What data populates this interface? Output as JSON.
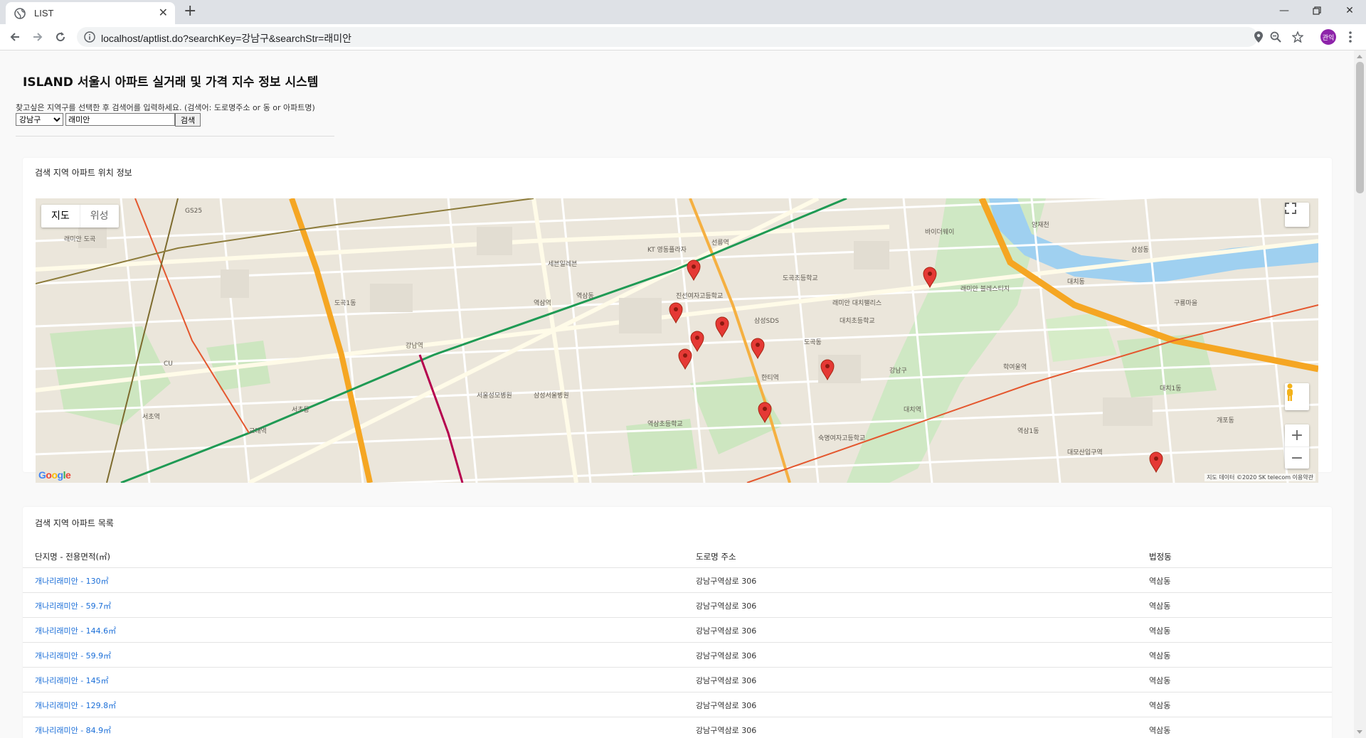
{
  "browser": {
    "tab_title": "LIST",
    "url": "localhost/aptlist.do?searchKey=강남구&searchStr=래미안",
    "profile_initials": "관익"
  },
  "page": {
    "title": "ISLAND 서울시 아파트 실거래 및 가격 지수 정보 시스템",
    "hint": "찾고싶은 지역구를 선택한 후 검색어를 입력하세요. (검색어: 도로명주소 or 동 or 아파트명)",
    "district_selected": "강남구",
    "search_value": "래미안",
    "search_button": "검색"
  },
  "map_card": {
    "title": "검색 지역 아파트 위치 정보",
    "map_tab": "지도",
    "satellite_tab": "위성",
    "attribution": "지도 데이터 ©2020 SK telecom   이용약관",
    "logo": "Google",
    "labels": [
      "세븐일레븐",
      "GS25",
      "CU",
      "역삼동",
      "강남역",
      "역삼역",
      "선릉역",
      "한티역",
      "대치동",
      "도곡동",
      "삼성동",
      "개포동",
      "강남구",
      "서초동",
      "서초역",
      "교대역",
      "양재천",
      "대치역",
      "학여울역",
      "대모산입구역",
      "역삼초등학교",
      "진선여자고등학교",
      "도곡초등학교",
      "숙명여자고등학교",
      "KT 영동플라자",
      "대치초등학교",
      "구룡마을",
      "삼성서울병원",
      "래미안 블레스티지",
      "래미안 대치팰리스",
      "래미안 도곡",
      "바이더웨이",
      "서울성모병원",
      "삼성SDS",
      "역삼1동",
      "대치1동",
      "도곡1동"
    ]
  },
  "list_card": {
    "title": "검색 지역 아파트 목록",
    "columns": [
      "단지명 - 전용면적(㎡)",
      "도로명 주소",
      "법정동"
    ],
    "rows": [
      [
        "개나리래미안 - 130㎡",
        "강남구역삼로 306",
        "역삼동"
      ],
      [
        "개나리래미안 - 59.7㎡",
        "강남구역삼로 306",
        "역삼동"
      ],
      [
        "개나리래미안 - 144.6㎡",
        "강남구역삼로 306",
        "역삼동"
      ],
      [
        "개나리래미안 - 59.9㎡",
        "강남구역삼로 306",
        "역삼동"
      ],
      [
        "개나리래미안 - 145㎡",
        "강남구역삼로 306",
        "역삼동"
      ],
      [
        "개나리래미안 - 129.8㎡",
        "강남구역삼로 306",
        "역삼동"
      ],
      [
        "개나리래미안 - 84.9㎡",
        "강남구역삼로 306",
        "역삼동"
      ]
    ]
  },
  "colors": {
    "link": "#1a6ed8",
    "map_base": "#ebe6db",
    "marker": "#e53935",
    "highway": "#f5a623",
    "subway_green": "#1f9a54",
    "river": "#9fd0f0"
  }
}
